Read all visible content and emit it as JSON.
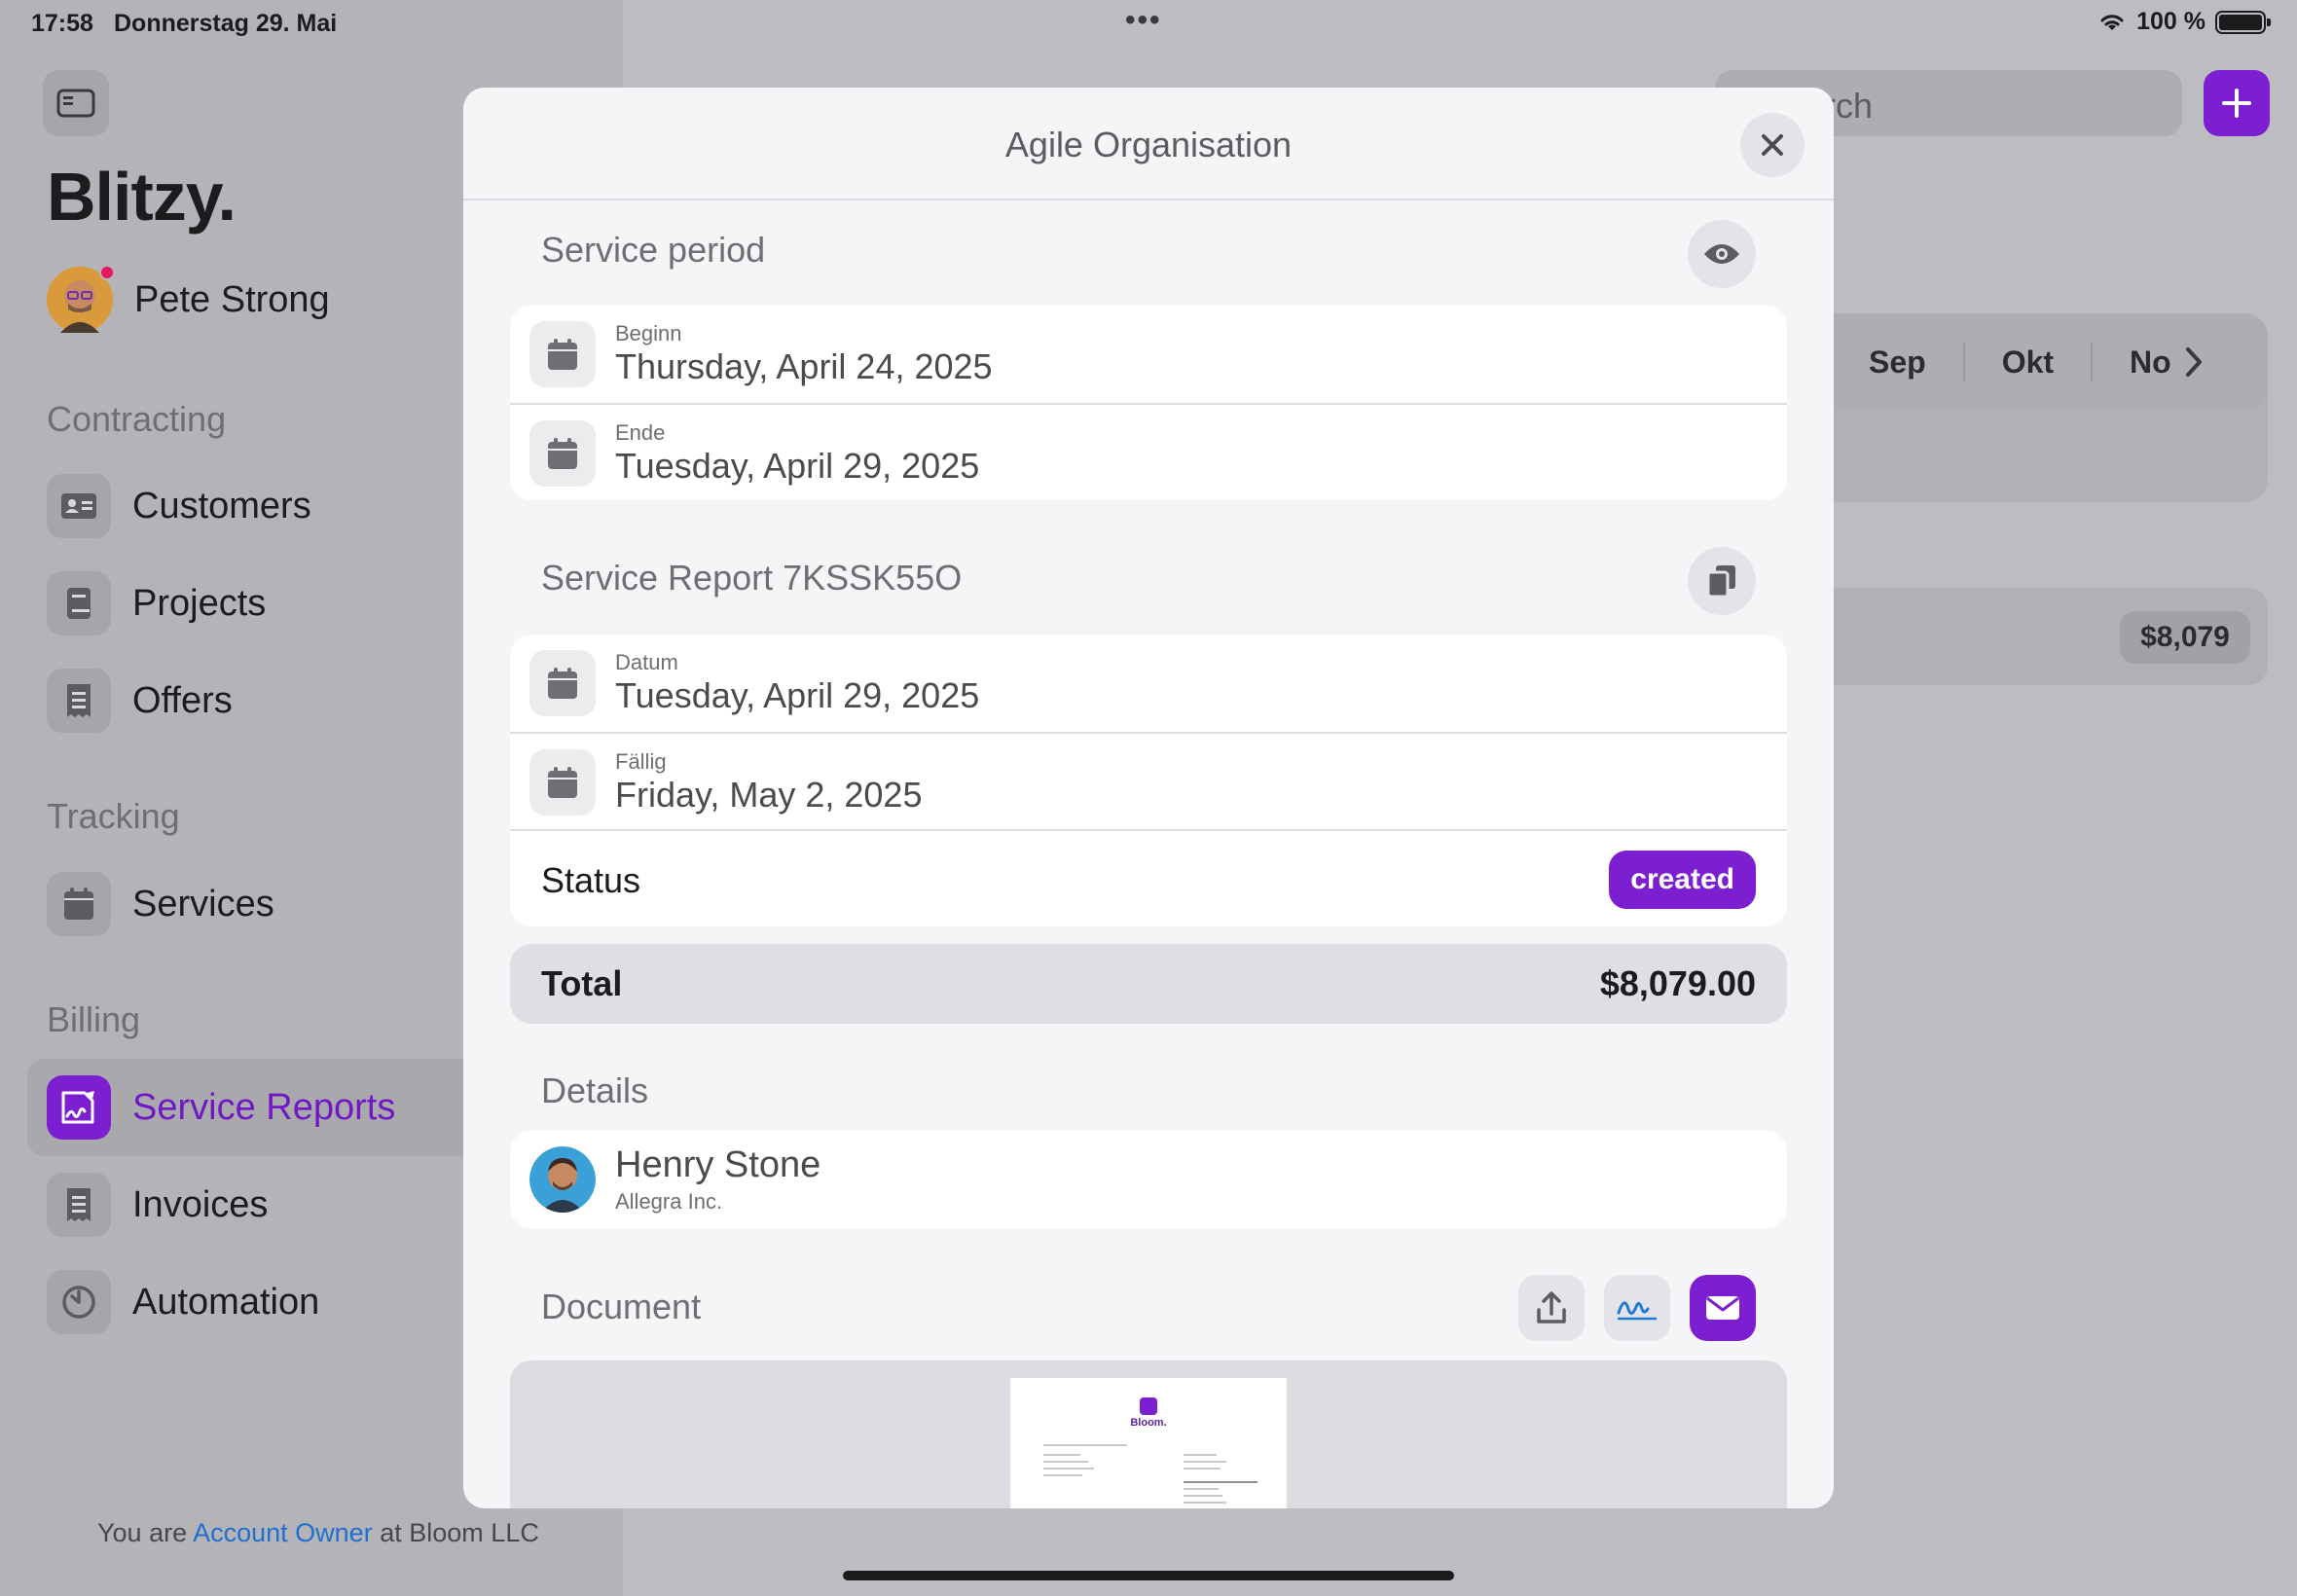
{
  "status_bar": {
    "time": "17:58",
    "date": "Donnerstag 29. Mai",
    "battery": "100 %"
  },
  "app": {
    "logo": "Blitzy.",
    "user_name": "Pete Strong",
    "sections": [
      {
        "title": "Contracting",
        "items": [
          {
            "label": "Customers",
            "icon": "id-card-icon"
          },
          {
            "label": "Projects",
            "icon": "book-icon"
          },
          {
            "label": "Offers",
            "icon": "receipt-icon"
          }
        ]
      },
      {
        "title": "Tracking",
        "items": [
          {
            "label": "Services",
            "icon": "calendar-icon"
          }
        ]
      },
      {
        "title": "Billing",
        "items": [
          {
            "label": "Service Reports",
            "icon": "signature-doc-icon",
            "active": true
          },
          {
            "label": "Invoices",
            "icon": "receipt-icon"
          },
          {
            "label": "Automation",
            "icon": "timer-icon"
          }
        ]
      }
    ],
    "footer": {
      "prefix": "You are",
      "role": "Account Owner",
      "middle": "at",
      "org": "Bloom LLC"
    },
    "accent_color": "#7c1fd1"
  },
  "background": {
    "search_placeholder": "Search",
    "search_visible": "rch",
    "months": [
      "Sep",
      "Okt",
      "No"
    ],
    "amount": "$8,079"
  },
  "modal": {
    "title": "Agile Organisation",
    "service_period": {
      "label": "Service period",
      "begin_caption": "Beginn",
      "begin_value": "Thursday, April 24, 2025",
      "end_caption": "Ende",
      "end_value": "Tuesday, April 29, 2025"
    },
    "report": {
      "label": "Service Report 7KSSK55O",
      "date_caption": "Datum",
      "date_value": "Tuesday, April 29, 2025",
      "due_caption": "Fällig",
      "due_value": "Friday, May 2, 2025",
      "status_label": "Status",
      "status_value": "created"
    },
    "total": {
      "label": "Total",
      "value": "$8,079.00"
    },
    "details": {
      "label": "Details",
      "person_name": "Henry Stone",
      "person_company": "Allegra Inc."
    },
    "document": {
      "label": "Document",
      "preview_brand": "Bloom."
    }
  }
}
